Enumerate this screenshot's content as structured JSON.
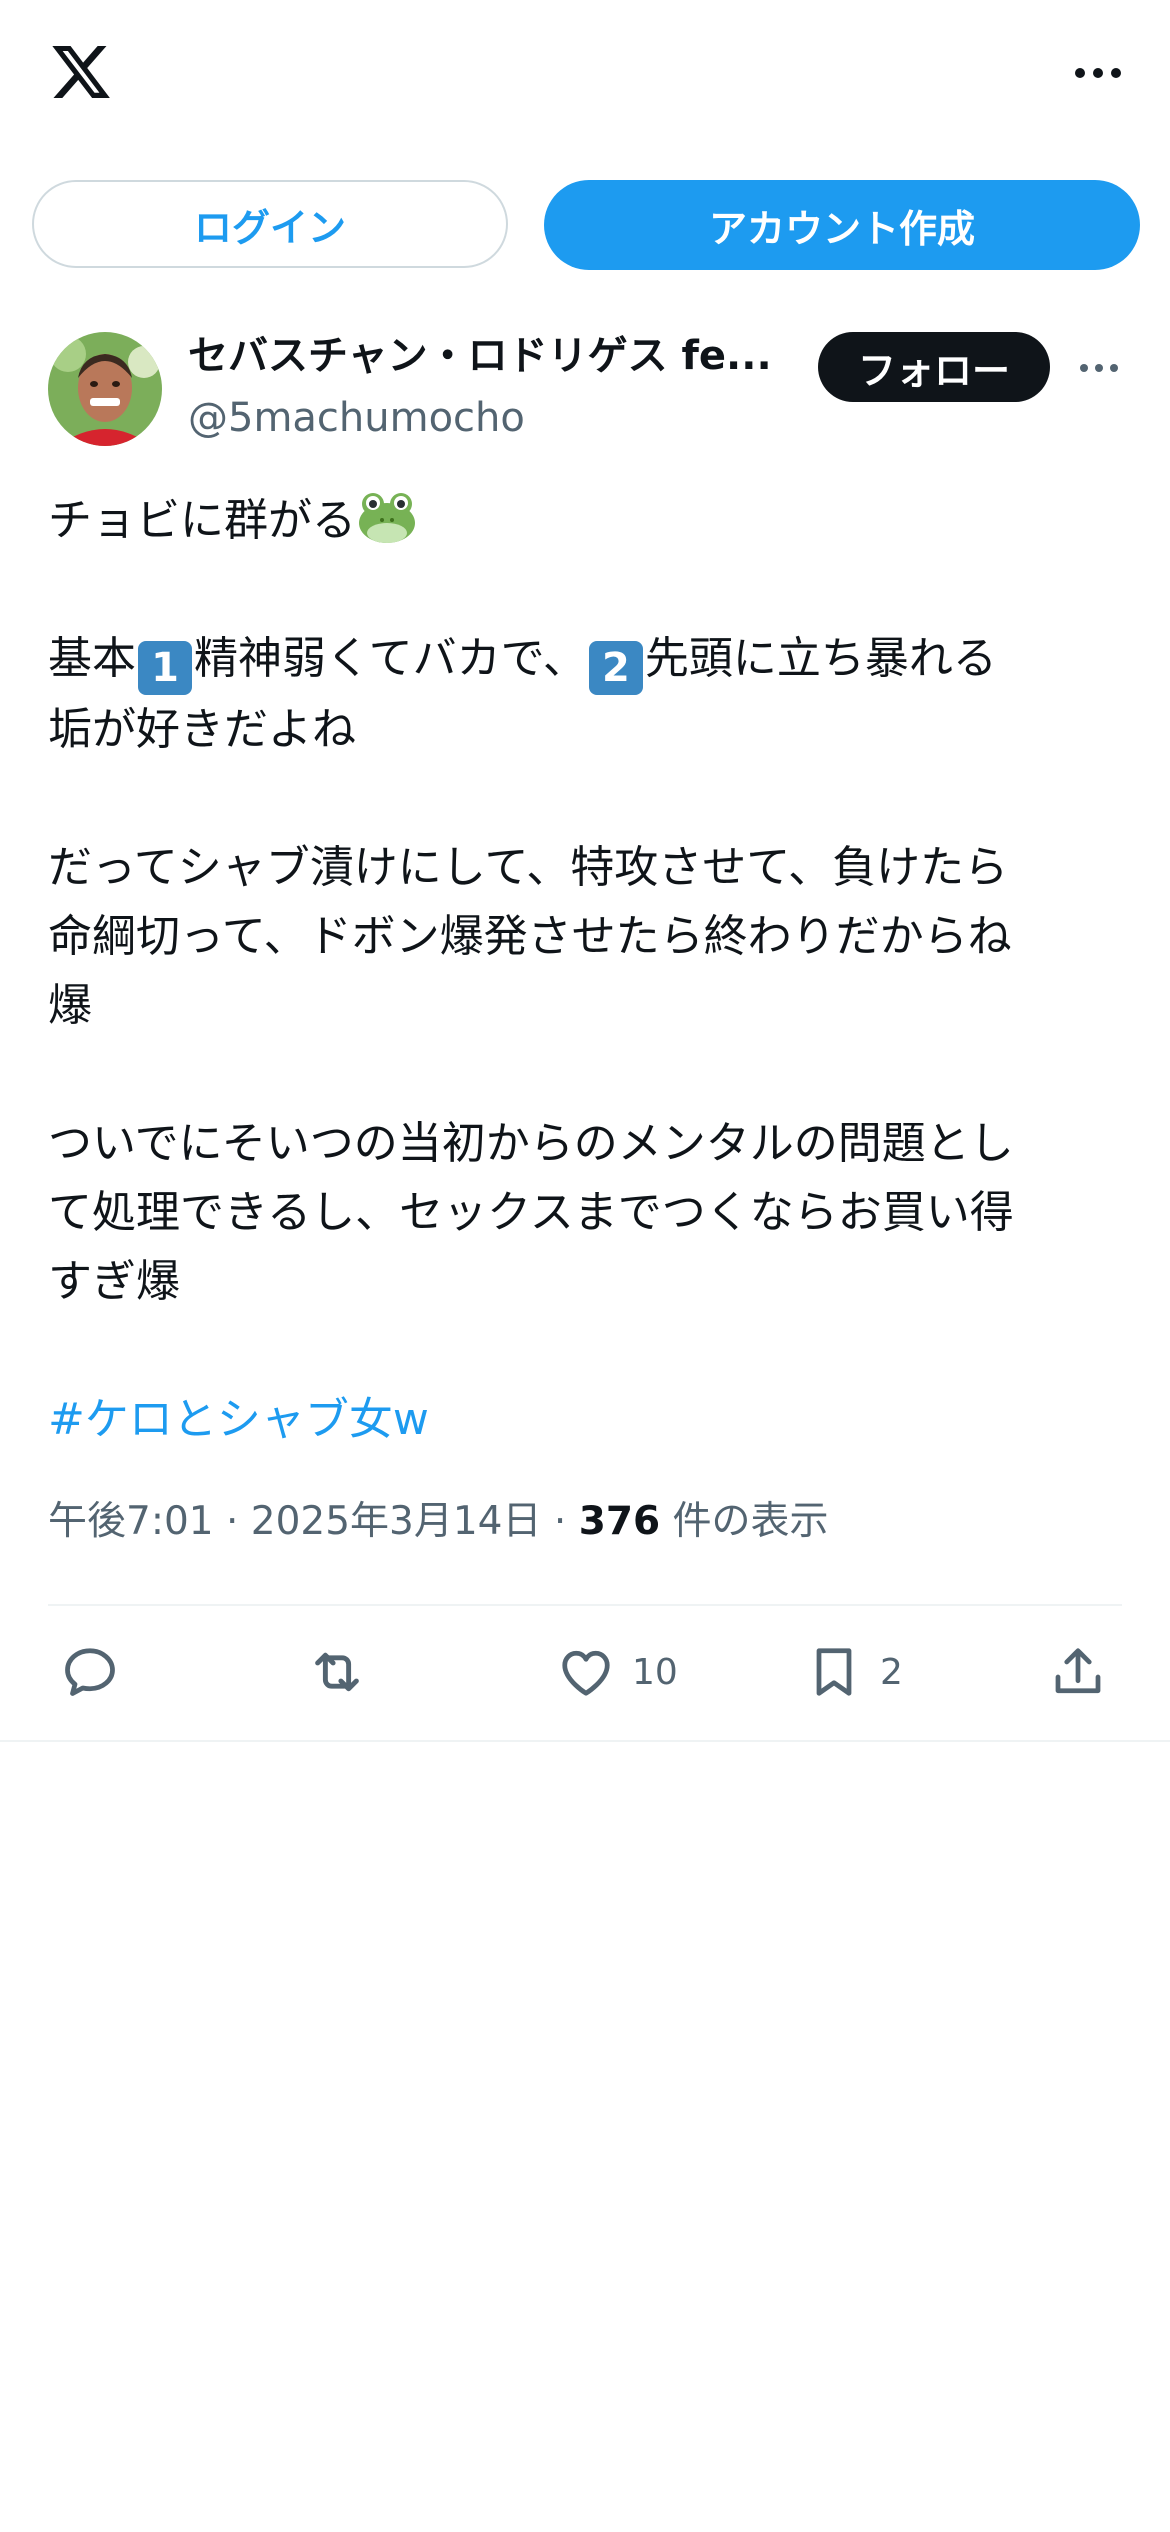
{
  "topbar": {
    "logo_icon": "x-logo-icon",
    "more_icon": "more-horizontal-icon"
  },
  "auth": {
    "login_label": "ログイン",
    "signup_label": "アカウント作成"
  },
  "tweet": {
    "author_name": "セバスチャン・ロドリゲス fe...",
    "author_handle": "@5machumocho",
    "follow_label": "フォロー",
    "body": {
      "line1": "チョビに群がる",
      "line2_a": "基本",
      "key1": "1",
      "line2_b": "精神弱くてバカで、",
      "key2": "2",
      "line2_c": "先頭に立ち暴れる",
      "line3": "垢が好きだよね",
      "para3_l1": "だってシャブ漬けにして、特攻させて、負けたら",
      "para3_l2": "命綱切って、ドボン爆発させたら終わりだからね",
      "para3_l3": "爆",
      "para4_l1": "ついでにそいつの当初からのメンタルの問題とし",
      "para4_l2": "て処理できるし、セックスまでつくならお買い得",
      "para4_l3": "すぎ爆",
      "hashtag": "#ケロとシャブ女w"
    },
    "meta": {
      "time": "午後7:01",
      "sep1": " · ",
      "date": "2025年3月14日",
      "sep2": " · ",
      "views_count": "376",
      "views_label": " 件の表示"
    },
    "actions": {
      "reply_icon": "reply-icon",
      "retweet_icon": "retweet-icon",
      "like_icon": "heart-icon",
      "like_count": "10",
      "bookmark_icon": "bookmark-icon",
      "bookmark_count": "2",
      "share_icon": "share-icon"
    }
  },
  "colors": {
    "accent": "#1d9bf0",
    "text": "#0f1419",
    "secondary_text": "#536471",
    "border": "#cfd9de",
    "divider": "#eff3f4"
  }
}
